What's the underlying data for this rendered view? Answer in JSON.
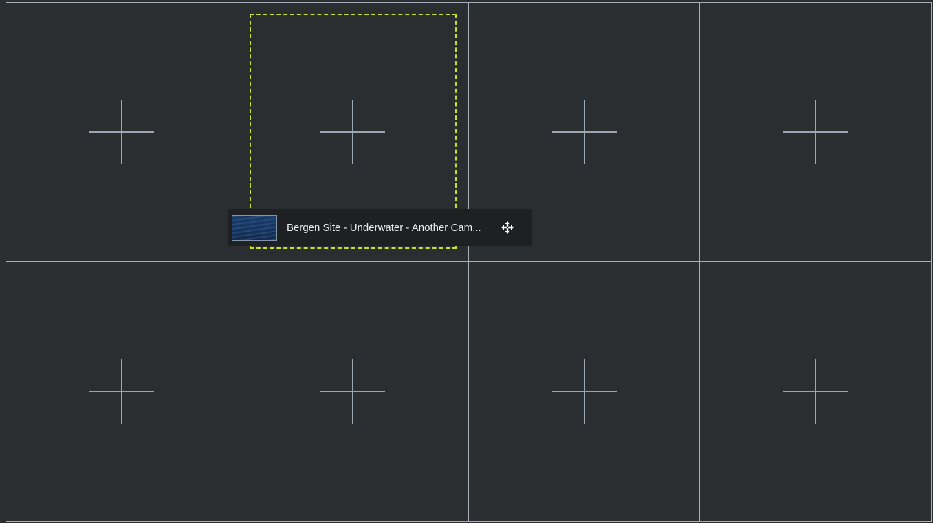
{
  "layout_grid": {
    "rows": 2,
    "columns": 4,
    "cells": [
      {
        "row": 1,
        "col": 1,
        "icon": "add-icon"
      },
      {
        "row": 1,
        "col": 2,
        "icon": "add-icon"
      },
      {
        "row": 1,
        "col": 3,
        "icon": "add-icon"
      },
      {
        "row": 1,
        "col": 4,
        "icon": "add-icon"
      },
      {
        "row": 2,
        "col": 1,
        "icon": "add-icon"
      },
      {
        "row": 2,
        "col": 2,
        "icon": "add-icon"
      },
      {
        "row": 2,
        "col": 3,
        "icon": "add-icon"
      },
      {
        "row": 2,
        "col": 4,
        "icon": "add-icon"
      }
    ]
  },
  "drag_item": {
    "label": "Bergen Site - Underwater - Another Cam...",
    "thumbnail": "underwater-camera-thumbnail",
    "handle_icon": "move-icon"
  },
  "colors": {
    "background": "#2b2e31",
    "grid_lines": "#a6b0ba",
    "plus_icon": "#9aa6b1",
    "drop_highlight": "#c8e02a",
    "chip_background": "#1e2022",
    "chip_text": "#e8eaec"
  }
}
